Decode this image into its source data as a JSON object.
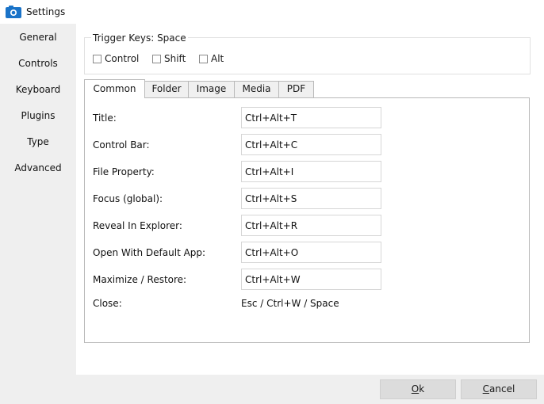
{
  "window": {
    "title": "Settings",
    "icon": "camera-app-icon"
  },
  "sidebar": {
    "items": [
      {
        "label": "General"
      },
      {
        "label": "Controls"
      },
      {
        "label": "Keyboard"
      },
      {
        "label": "Plugins"
      },
      {
        "label": "Type"
      },
      {
        "label": "Advanced"
      }
    ]
  },
  "trigger": {
    "label": "Trigger Keys: Space",
    "options": [
      {
        "label": "Control",
        "checked": false
      },
      {
        "label": "Shift",
        "checked": false
      },
      {
        "label": "Alt",
        "checked": false
      }
    ]
  },
  "tabs": [
    {
      "label": "Common",
      "active": true
    },
    {
      "label": "Folder",
      "active": false
    },
    {
      "label": "Image",
      "active": false
    },
    {
      "label": "Media",
      "active": false
    },
    {
      "label": "PDF",
      "active": false
    }
  ],
  "shortcuts": [
    {
      "label": "Title:",
      "value": "Ctrl+Alt+T"
    },
    {
      "label": "Control Bar:",
      "value": "Ctrl+Alt+C"
    },
    {
      "label": "File Property:",
      "value": "Ctrl+Alt+I"
    },
    {
      "label": "Focus (global):",
      "value": "Ctrl+Alt+S"
    },
    {
      "label": "Reveal In Explorer:",
      "value": "Ctrl+Alt+R"
    },
    {
      "label": "Open With Default App:",
      "value": "Ctrl+Alt+O"
    },
    {
      "label": "Maximize / Restore:",
      "value": "Ctrl+Alt+W"
    },
    {
      "label": "Close:",
      "value": "Esc / Ctrl+W / Space"
    }
  ],
  "buttons": {
    "ok_first": "O",
    "ok_rest": "k",
    "cancel_first": "C",
    "cancel_rest": "ancel"
  },
  "colors": {
    "sidebar_bg": "#efefef",
    "button_bg": "#dcdcdc",
    "icon_blue": "#1a73c8"
  }
}
